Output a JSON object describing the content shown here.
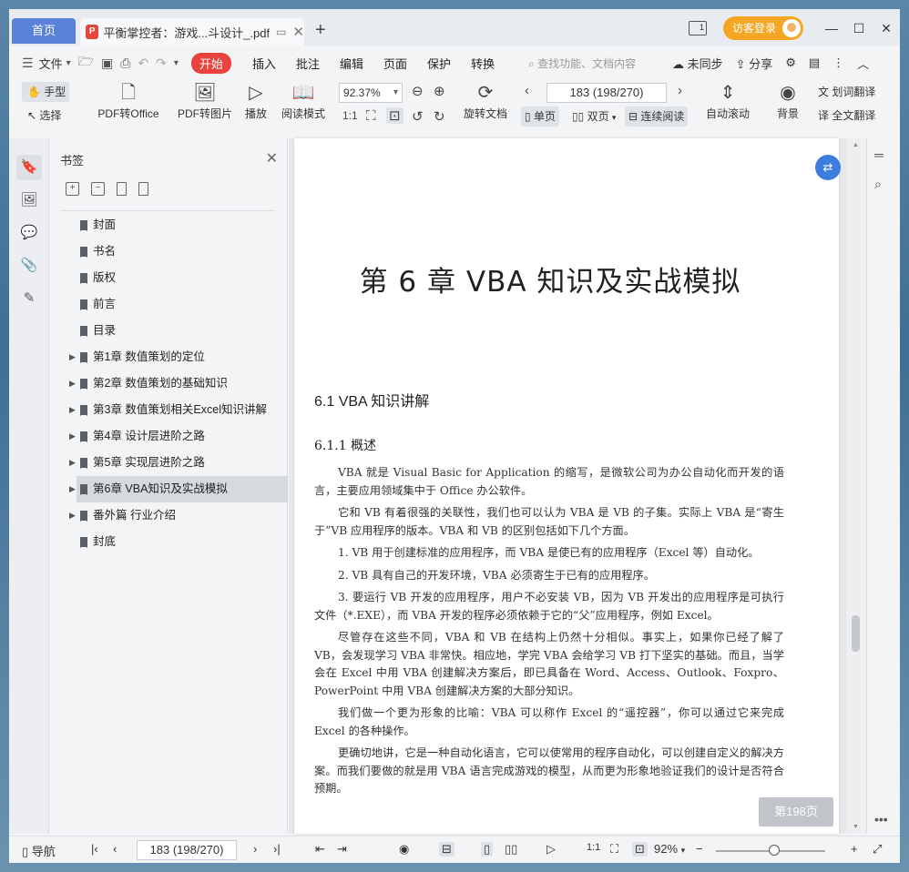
{
  "titlebar": {
    "home_tab": "首页",
    "doc_tab": "平衡掌控者：游戏...斗设计_.pdf",
    "visitor_login": "访客登录"
  },
  "menubar": {
    "file": "文件",
    "start": "开始",
    "items": [
      "插入",
      "批注",
      "编辑",
      "页面",
      "保护",
      "转换"
    ],
    "search_placeholder": "查找功能、文档内容",
    "sync": "未同步",
    "share": "分享"
  },
  "toolbar": {
    "hand": "手型",
    "select": "选择",
    "pdf_to_office": "PDF转Office",
    "pdf_to_image": "PDF转图片",
    "play": "播放",
    "read_mode": "阅读模式",
    "zoom": "92.37%",
    "rotate": "旋转文档",
    "page_indicator": "183 (198/270)",
    "single_page": "单页",
    "double_page": "双页",
    "continuous": "连续阅读",
    "auto_scroll": "自动滚动",
    "background": "背景",
    "word_translate": "划词翻译",
    "full_translate": "全文翻译"
  },
  "panel": {
    "title": "书签",
    "bookmarks": [
      {
        "label": "封面",
        "expandable": false
      },
      {
        "label": "书名",
        "expandable": false
      },
      {
        "label": "版权",
        "expandable": false
      },
      {
        "label": "前言",
        "expandable": false
      },
      {
        "label": "目录",
        "expandable": false
      },
      {
        "label": "第1章  数值策划的定位",
        "expandable": true
      },
      {
        "label": "第2章  数值策划的基础知识",
        "expandable": true
      },
      {
        "label": "第3章  数值策划相关Excel知识讲解",
        "expandable": true
      },
      {
        "label": "第4章  设计层进阶之路",
        "expandable": true
      },
      {
        "label": "第5章  实现层进阶之路",
        "expandable": true
      },
      {
        "label": "第6章  VBA知识及实战模拟",
        "expandable": true,
        "selected": true
      },
      {
        "label": "番外篇  行业介绍",
        "expandable": true
      },
      {
        "label": "封底",
        "expandable": false
      }
    ]
  },
  "document": {
    "chapter_title": "第 6 章    VBA 知识及实战模拟",
    "section_title": "6.1   VBA 知识讲解",
    "subsection_title": "6.1.1    概述",
    "paragraphs": [
      "VBA 就是 Visual Basic for Application 的缩写，是微软公司为办公自动化而开发的语言，主要应用领域集中于 Office 办公软件。",
      "它和 VB 有着很强的关联性，我们也可以认为 VBA 是 VB 的子集。实际上 VBA 是“寄生于”VB 应用程序的版本。VBA 和 VB 的区别包括如下几个方面。",
      "1. VB 用于创建标准的应用程序，而 VBA 是使已有的应用程序（Excel 等）自动化。",
      "2. VB 具有自己的开发环境，VBA 必须寄生于已有的应用程序。",
      "3. 要运行 VB 开发的应用程序，用户不必安装 VB，因为 VB 开发出的应用程序是可执行文件（*.EXE），而 VBA 开发的程序必须依赖于它的“父”应用程序，例如 Excel。",
      "尽管存在这些不同，VBA 和 VB 在结构上仍然十分相似。事实上，如果你已经了解了 VB，会发现学习 VBA 非常快。相应地，学完 VBA 会给学习 VB 打下坚实的基础。而且，当学会在 Excel 中用 VBA 创建解决方案后，即已具备在 Word、Access、Outlook、Foxpro、PowerPoint 中用 VBA 创建解决方案的大部分知识。",
      "我们做一个更为形象的比喻：VBA 可以称作 Excel 的“遥控器”，你可以通过它来完成 Excel 的各种操作。",
      "更确切地讲，它是一种自动化语言，它可以使常用的程序自动化，可以创建自定义的解决方案。而我们要做的就是用 VBA 语言完成游戏的模型，从而更为形象地验证我们的设计是否符合预期。"
    ],
    "page_badge": "第198页"
  },
  "statusbar": {
    "nav": "导航",
    "page": "183 (198/270)",
    "zoom": "92%"
  }
}
